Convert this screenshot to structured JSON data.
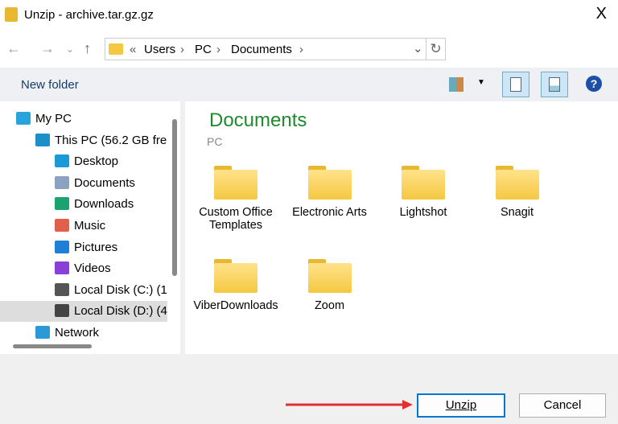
{
  "window": {
    "title": "Unzip - archive.tar.gz.gz",
    "close": "X"
  },
  "address": {
    "overflow": "«",
    "crumbs": [
      "Users",
      "PC",
      "Documents"
    ],
    "sep": "›"
  },
  "toolbar": {
    "new_folder": "New folder",
    "help": "?"
  },
  "tree": [
    {
      "label": "My PC",
      "icon": "my-pc-icon",
      "color": "#29a3dc",
      "indent": 0
    },
    {
      "label": "This PC (56.2 GB free",
      "icon": "monitor-icon",
      "color": "#1b8fc8",
      "indent": 1
    },
    {
      "label": "Desktop",
      "icon": "desktop-icon",
      "color": "#1a9ad6",
      "indent": 2
    },
    {
      "label": "Documents",
      "icon": "documents-icon",
      "color": "#8ba2c0",
      "indent": 2
    },
    {
      "label": "Downloads",
      "icon": "downloads-icon",
      "color": "#1aa370",
      "indent": 2
    },
    {
      "label": "Music",
      "icon": "music-icon",
      "color": "#e0604a",
      "indent": 2
    },
    {
      "label": "Pictures",
      "icon": "pictures-icon",
      "color": "#1f7fd6",
      "indent": 2
    },
    {
      "label": "Videos",
      "icon": "videos-icon",
      "color": "#8a3fd6",
      "indent": 2
    },
    {
      "label": "Local Disk (C:) (1",
      "icon": "drive-c-icon",
      "color": "#555",
      "indent": 2
    },
    {
      "label": "Local Disk (D:) (4",
      "icon": "drive-d-icon",
      "color": "#444",
      "indent": 2
    },
    {
      "label": "Network",
      "icon": "network-icon",
      "color": "#2a9ad6",
      "indent": 1
    }
  ],
  "main": {
    "title": "Documents",
    "subtitle": "PC",
    "folders": [
      "Custom Office Templates",
      "Electronic Arts",
      "Lightshot",
      "Snagit",
      "ViberDownloads",
      "Zoom"
    ]
  },
  "buttons": {
    "unzip": "Unzip",
    "cancel": "Cancel"
  },
  "colors": {
    "accent": "#0078d4",
    "heading": "#1e8a2e",
    "arrow": "#e03030"
  }
}
